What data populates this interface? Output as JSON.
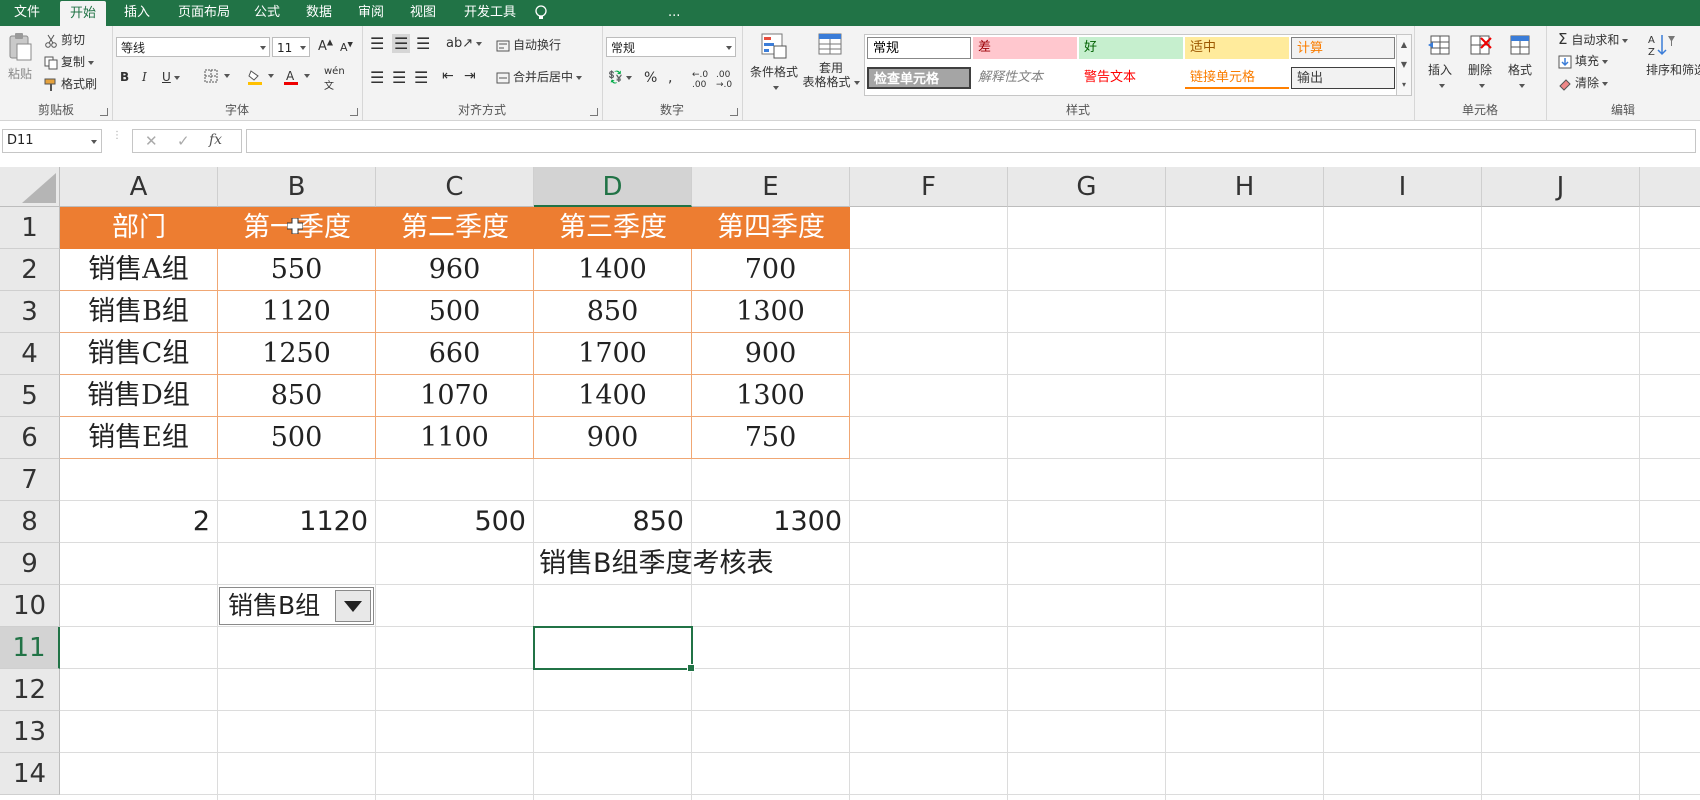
{
  "tabs": [
    "文件",
    "开始",
    "插入",
    "页面布局",
    "公式",
    "数据",
    "审阅",
    "视图",
    "开发工具",
    "..."
  ],
  "active_tab": "开始",
  "ribbon": {
    "clipboard": {
      "paste": "粘贴",
      "cut": "剪切",
      "copy": "复制",
      "format_painter": "格式刷",
      "label": "剪贴板"
    },
    "font": {
      "name": "等线",
      "size": "11",
      "label": "字体"
    },
    "align": {
      "wrap": "自动换行",
      "merge": "合并后居中",
      "label": "对齐方式"
    },
    "number": {
      "format": "常规",
      "label": "数字"
    },
    "styles": {
      "cond_format": "条件格式",
      "table_format_1": "套用",
      "table_format_2": "表格格式",
      "items": [
        "常规",
        "差",
        "好",
        "适中",
        "计算",
        "检查单元格",
        "解释性文本",
        "警告文本",
        "链接单元格",
        "输出"
      ],
      "label": "样式"
    },
    "cells": {
      "insert": "插入",
      "delete": "删除",
      "format": "格式",
      "label": "单元格"
    },
    "editing": {
      "autosum": "自动求和",
      "fill": "填充",
      "clear": "清除",
      "sort": "排序和筛选",
      "label": "编辑"
    }
  },
  "name_box": "D11",
  "columns": [
    "A",
    "B",
    "C",
    "D",
    "E",
    "F",
    "G",
    "H",
    "I",
    "J"
  ],
  "rows": [
    "1",
    "2",
    "3",
    "4",
    "5",
    "6",
    "7",
    "8",
    "9",
    "10",
    "11",
    "12",
    "13",
    "14"
  ],
  "table": {
    "header": [
      "部门",
      "第一季度",
      "第二季度",
      "第三季度",
      "第四季度"
    ],
    "rows": [
      [
        "销售A组",
        "550",
        "960",
        "1400",
        "700"
      ],
      [
        "销售B组",
        "1120",
        "500",
        "850",
        "1300"
      ],
      [
        "销售C组",
        "1250",
        "660",
        "1700",
        "900"
      ],
      [
        "销售D组",
        "850",
        "1070",
        "1400",
        "1300"
      ],
      [
        "销售E组",
        "500",
        "1100",
        "900",
        "750"
      ]
    ]
  },
  "row8": [
    "2",
    "1120",
    "500",
    "850",
    "1300"
  ],
  "title_d9": "销售B组季度考核表",
  "combo_b10": "销售B组",
  "colors": {
    "excel_green": "#217346",
    "table_header": "#ed7d31",
    "table_border": "#f0a774"
  }
}
